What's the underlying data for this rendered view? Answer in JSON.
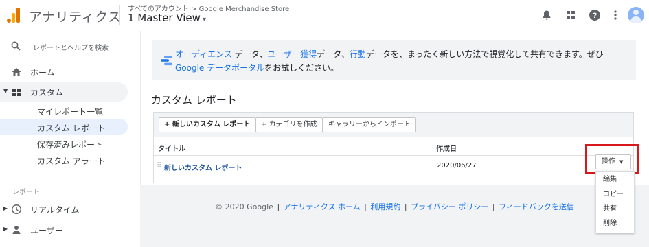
{
  "header": {
    "app_title": "アナリティクス",
    "breadcrumb": "すべてのアカウント > Google Merchandise Store",
    "view_name": "1 Master View",
    "view_caret": "▾"
  },
  "sidebar": {
    "search_placeholder": "レポートとヘルプを検索",
    "home_label": "ホーム",
    "custom_label": "カスタム",
    "sub_items": [
      {
        "label": "マイレポート一覧"
      },
      {
        "label": "カスタム レポート"
      },
      {
        "label": "保存済みレポート"
      },
      {
        "label": "カスタム アラート"
      }
    ],
    "reports_section": "レポート",
    "realtime_label": "リアルタイム",
    "user_label": "ユーザー"
  },
  "banner": {
    "link_audience": "オーディエンス",
    "text1": " データ、",
    "link_acquisition": "ユーザー獲得",
    "text2": "データ、",
    "link_behavior": "行動",
    "text3": "データを、まったく新しい方法で視覚化して共有できます。ぜひ",
    "link_portal_google": "Google ",
    "link_portal": "データポータル",
    "text4": "をお試しください。"
  },
  "page": {
    "section_title": "カスタム レポート"
  },
  "table": {
    "buttons": {
      "new_report": "+ 新しいカスタム レポート",
      "new_category": "+ カテゴリを作成",
      "import_gallery": "ギャラリーからインポート"
    },
    "columns": {
      "title": "タイトル",
      "created": "作成日"
    },
    "rows": [
      {
        "name": "新しいカスタム レポート",
        "date": "2020/06/27"
      }
    ],
    "action_label": "操作",
    "action_caret": "▼"
  },
  "footer": {
    "copyright": "© 2020 Google",
    "links": [
      "アナリティクス ホーム",
      "利用規約",
      "プライバシー ポリシー",
      "フィードバックを送信"
    ],
    "separator": "|"
  },
  "dropdown": {
    "items": [
      "編集",
      "コピー",
      "共有",
      "削除"
    ]
  },
  "colors": {
    "accent": "#1a73e8",
    "highlight_box": "#d7191c",
    "logo_orange": "#e37400",
    "logo_yellow": "#f9ab00"
  }
}
